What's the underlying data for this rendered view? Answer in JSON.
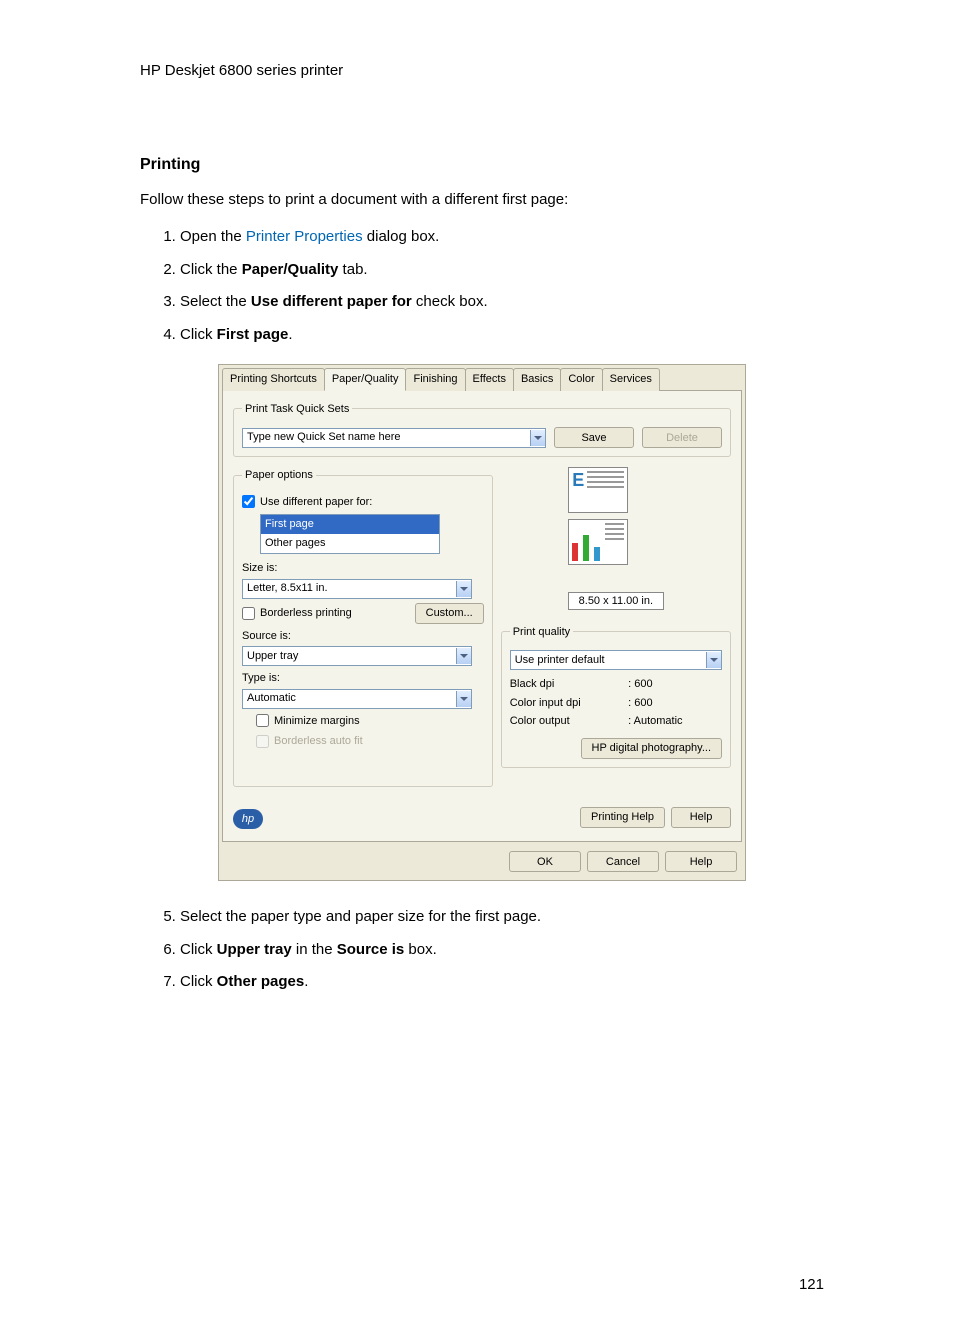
{
  "header": {
    "title": "HP Deskjet 6800 series printer"
  },
  "section": {
    "heading": "Printing"
  },
  "intro": "Follow these steps to print a document with a different first page:",
  "steps_a": [
    {
      "pre": "Open the ",
      "link": "Printer Properties",
      "post": " dialog box."
    },
    {
      "pre": "Click the ",
      "bold": "Paper/Quality",
      "post": " tab."
    },
    {
      "pre": "Select the ",
      "bold": "Use different paper for",
      "post": " check box."
    },
    {
      "pre": "Click ",
      "bold": "First page",
      "post": "."
    }
  ],
  "steps_b": [
    {
      "text": "Select the paper type and paper size for the first page."
    },
    {
      "pre": "Click ",
      "bold": "Upper tray",
      "mid": " in the ",
      "bold2": "Source is",
      "post": " box."
    },
    {
      "pre": "Click ",
      "bold": "Other pages",
      "post": "."
    }
  ],
  "dialog": {
    "tabs": [
      "Printing Shortcuts",
      "Paper/Quality",
      "Finishing",
      "Effects",
      "Basics",
      "Color",
      "Services"
    ],
    "active_tab_index": 1,
    "quicksets": {
      "legend": "Print Task Quick Sets",
      "placeholder": "Type new Quick Set name here",
      "save": "Save",
      "delete": "Delete"
    },
    "paper_options": {
      "legend": "Paper options",
      "use_diff": "Use different paper for:",
      "list": [
        "First page",
        "Other pages"
      ],
      "selected_index": 0,
      "size_is": "Size is:",
      "size_value": "Letter, 8.5x11 in.",
      "borderless": "Borderless printing",
      "custom": "Custom...",
      "source_is": "Source is:",
      "source_value": "Upper tray",
      "type_is": "Type is:",
      "type_value": "Automatic",
      "minimize": "Minimize margins",
      "borderless_auto": "Borderless auto fit"
    },
    "preview": {
      "dim": "8.50 x 11.00 in."
    },
    "print_quality": {
      "legend": "Print quality",
      "value": "Use printer default",
      "black_dpi_label": "Black dpi",
      "black_dpi_val": ": 600",
      "color_input_label": "Color input dpi",
      "color_input_val": ": 600",
      "color_output_label": "Color output",
      "color_output_val": ": Automatic",
      "hp_digital": "HP digital photography..."
    },
    "buttons": {
      "printing_help": "Printing Help",
      "help": "Help",
      "ok": "OK",
      "cancel": "Cancel",
      "help2": "Help"
    },
    "hp_logo": "hp"
  },
  "page_number": "121"
}
